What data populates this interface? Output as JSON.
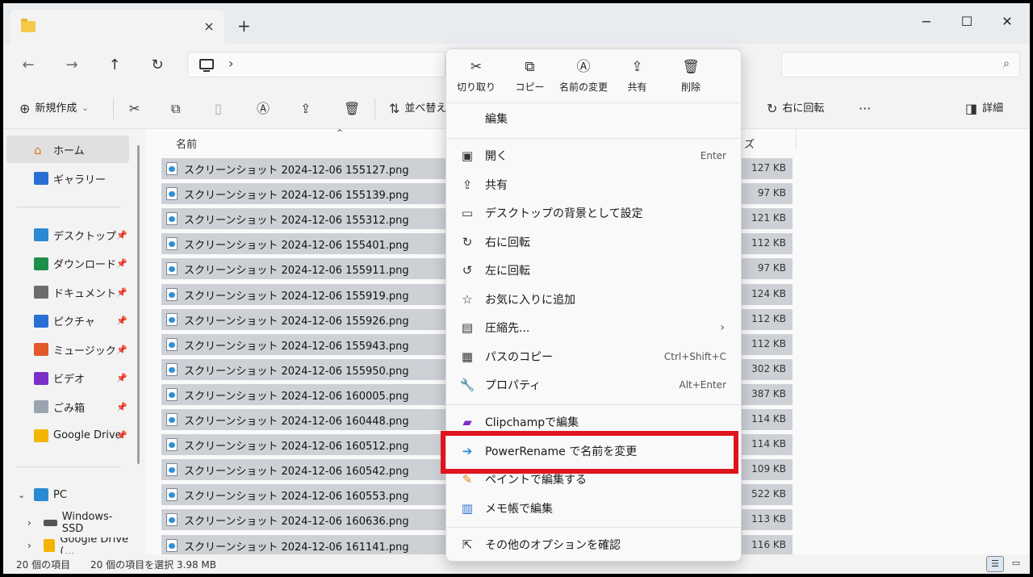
{
  "window": {
    "tab_close": "×",
    "new_tab": "+",
    "minimize": "−",
    "maximize": "☐",
    "close": "✕"
  },
  "nav": {
    "back": "←",
    "forward": "→",
    "up": "↑",
    "refresh": "↻",
    "chevron": "›",
    "search_icon": "⌕"
  },
  "commandbar": {
    "new_label": "新規作成",
    "sort_label": "並べ替え",
    "rotate_right": "右に回転",
    "more": "···",
    "details": "詳細"
  },
  "sidebar": {
    "home": "ホーム",
    "gallery": "ギャラリー",
    "pinned": [
      {
        "label": "デスクトップ",
        "color": "#2a8ad4"
      },
      {
        "label": "ダウンロード",
        "color": "#1e8f4a"
      },
      {
        "label": "ドキュメント",
        "color": "#6b6b6b"
      },
      {
        "label": "ピクチャ",
        "color": "#2a6fd4"
      },
      {
        "label": "ミュージック",
        "color": "#e05a2a"
      },
      {
        "label": "ビデオ",
        "color": "#7b2fc9"
      },
      {
        "label": "ごみ箱",
        "color": "#9aa5b1"
      },
      {
        "label": "Google Drive",
        "color": "#f4b400"
      }
    ],
    "pc": "PC",
    "drives": [
      "Windows-SSD",
      "Google Drive (…"
    ]
  },
  "files": {
    "col_name": "名前",
    "col_size": "ズ",
    "rows": [
      {
        "name": "スクリーンショット 2024-12-06 155127.png",
        "size": "127 KB"
      },
      {
        "name": "スクリーンショット 2024-12-06 155139.png",
        "size": "97 KB"
      },
      {
        "name": "スクリーンショット 2024-12-06 155312.png",
        "size": "121 KB"
      },
      {
        "name": "スクリーンショット 2024-12-06 155401.png",
        "size": "112 KB"
      },
      {
        "name": "スクリーンショット 2024-12-06 155911.png",
        "size": "97 KB"
      },
      {
        "name": "スクリーンショット 2024-12-06 155919.png",
        "size": "124 KB"
      },
      {
        "name": "スクリーンショット 2024-12-06 155926.png",
        "size": "112 KB"
      },
      {
        "name": "スクリーンショット 2024-12-06 155943.png",
        "size": "112 KB"
      },
      {
        "name": "スクリーンショット 2024-12-06 155950.png",
        "size": "302 KB"
      },
      {
        "name": "スクリーンショット 2024-12-06 160005.png",
        "size": "387 KB"
      },
      {
        "name": "スクリーンショット 2024-12-06 160448.png",
        "size": "114 KB"
      },
      {
        "name": "スクリーンショット 2024-12-06 160512.png",
        "size": "114 KB"
      },
      {
        "name": "スクリーンショット 2024-12-06 160542.png",
        "size": "109 KB"
      },
      {
        "name": "スクリーンショット 2024-12-06 160553.png",
        "size": "522 KB"
      },
      {
        "name": "スクリーンショット 2024-12-06 160636.png",
        "size": "113 KB"
      },
      {
        "name": "スクリーンショット 2024-12-06 161141.png",
        "size": "116 KB"
      }
    ]
  },
  "status": {
    "items": "20 個の項目",
    "selected": "20 個の項目を選択  3.98 MB"
  },
  "context_menu": {
    "quick": [
      {
        "icon": "✂",
        "label": "切り取り"
      },
      {
        "icon": "⧉",
        "label": "コピー"
      },
      {
        "icon": "Ⓐ",
        "label": "名前の変更"
      },
      {
        "icon": "⇪",
        "label": "共有"
      },
      {
        "icon": "🗑",
        "label": "削除"
      }
    ],
    "edit": "編集",
    "items": [
      {
        "icon": "▣",
        "label": "開く",
        "shortcut": "Enter"
      },
      {
        "icon": "⇪",
        "label": "共有",
        "shortcut": ""
      },
      {
        "icon": "▭",
        "label": "デスクトップの背景として設定",
        "shortcut": ""
      },
      {
        "icon": "↻",
        "label": "右に回転",
        "shortcut": ""
      },
      {
        "icon": "↺",
        "label": "左に回転",
        "shortcut": ""
      },
      {
        "icon": "☆",
        "label": "お気に入りに追加",
        "shortcut": ""
      },
      {
        "icon": "▤",
        "label": "圧縮先...",
        "shortcut": "",
        "arrow": "›"
      },
      {
        "icon": "▦",
        "label": "パスのコピー",
        "shortcut": "Ctrl+Shift+C"
      },
      {
        "icon": "🔧",
        "label": "プロパティ",
        "shortcut": "Alt+Enter"
      }
    ],
    "items2": [
      {
        "icon": "▰",
        "label": "Clipchampで編集"
      },
      {
        "icon": "➔",
        "label": "PowerRename で名前を変更"
      },
      {
        "icon": "✎",
        "label": "ペイントで編集する"
      },
      {
        "icon": "▥",
        "label": "メモ帳で編集"
      }
    ],
    "more_options": {
      "icon": "⇱",
      "label": "その他のオプションを確認"
    }
  },
  "colors": {
    "highlight": "#e0141e",
    "selection": "#cdd1d6"
  }
}
